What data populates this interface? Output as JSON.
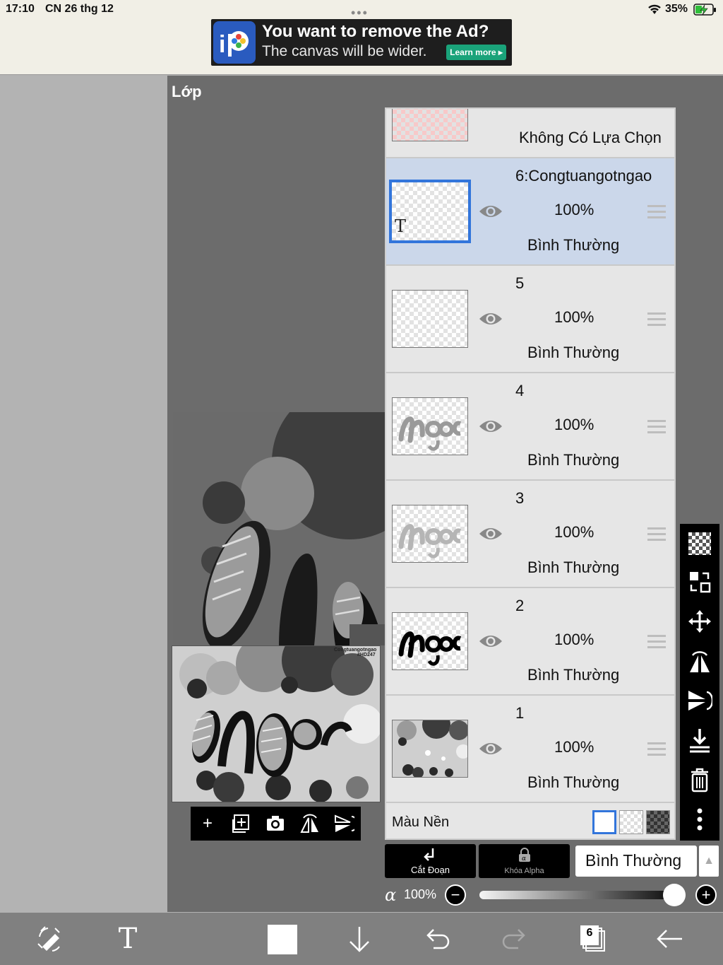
{
  "status_bar": {
    "time": "17:10",
    "date": "CN 26 thg 12",
    "battery": "35%",
    "wifi_icon": "wifi-icon",
    "battery_icon": "battery-charging-icon"
  },
  "ad": {
    "title": "You want to remove the Ad?",
    "subtitle": "The canvas will be wider.",
    "button": "Learn more ▸"
  },
  "panel": {
    "title": "Lớp"
  },
  "layers": {
    "top_partial": {
      "label": "Không Có Lựa Chọn"
    },
    "items": [
      {
        "name": "6:Congtuangotngao",
        "opacity": "100%",
        "blend": "Bình Thường",
        "selected": true,
        "type": "text",
        "glyph": "T"
      },
      {
        "name": "5",
        "opacity": "100%",
        "blend": "Bình Thường",
        "selected": false
      },
      {
        "name": "4",
        "opacity": "100%",
        "blend": "Bình Thường",
        "selected": false
      },
      {
        "name": "3",
        "opacity": "100%",
        "blend": "Bình Thường",
        "selected": false
      },
      {
        "name": "2",
        "opacity": "100%",
        "blend": "Bình Thường",
        "selected": false
      },
      {
        "name": "1",
        "opacity": "100%",
        "blend": "Bình Thường",
        "selected": false
      }
    ],
    "background": {
      "label": "Màu Nền"
    }
  },
  "thumbnail_art": {
    "watermark_line1": "Congtuangotngao",
    "watermark_line2": "#HD247"
  },
  "controls": {
    "clip_label": "Cắt Đoạn",
    "alpha_lock_label": "Khóa Alpha",
    "blend_mode": "Bình Thường",
    "alpha_symbol": "α",
    "alpha_value": "100%",
    "alpha_fraction": 1.0
  },
  "bottom_bar": {
    "layer_count": "6"
  },
  "colors": {
    "selected_row": "#cbd7ea",
    "selection_border": "#3275db",
    "panel_bg": "#6c6c6c",
    "ad_button": "#1aa37a"
  }
}
